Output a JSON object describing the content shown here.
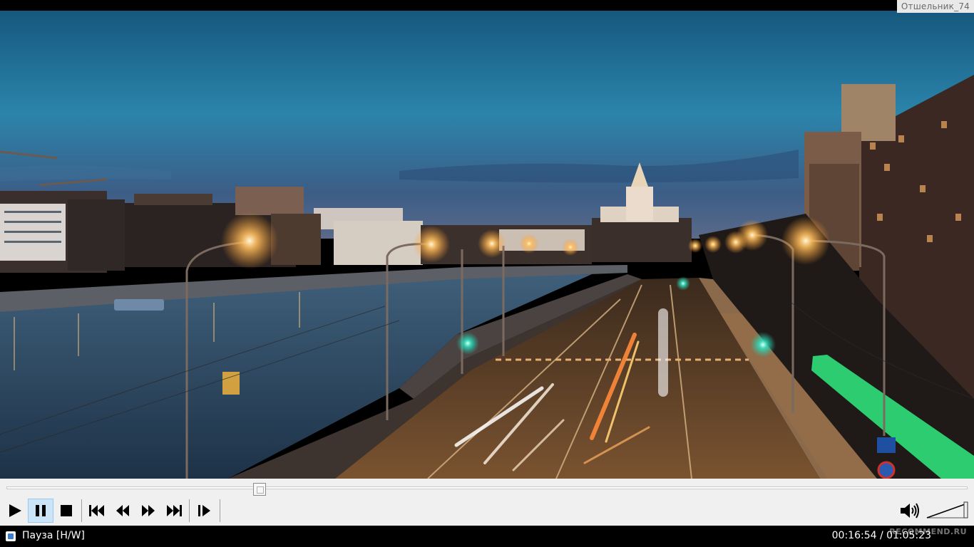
{
  "video": {
    "watermark": "Отшельник_74",
    "colors": {
      "sky_top": "#1f6f95",
      "sky_mid": "#2e86ad",
      "sky_low": "#3a5f8a",
      "river": "#2c4a63",
      "road": "#6b4a2b",
      "light": "#ffb347",
      "neon": "#3cf08a"
    }
  },
  "seek": {
    "progress_fraction": 0.263
  },
  "controls": {
    "buttons": [
      {
        "name": "play-button",
        "icon": "play-icon"
      },
      {
        "name": "pause-button",
        "icon": "pause-icon",
        "active": true
      },
      {
        "name": "stop-button",
        "icon": "stop-icon"
      },
      {
        "name": "previous-button",
        "icon": "skip-back-icon"
      },
      {
        "name": "rewind-button",
        "icon": "rewind-icon"
      },
      {
        "name": "forward-button",
        "icon": "fast-forward-icon"
      },
      {
        "name": "next-button",
        "icon": "skip-forward-icon"
      },
      {
        "name": "frame-step-button",
        "icon": "frame-step-icon"
      }
    ],
    "volume_icon": "speaker-icon",
    "volume_level": 1.0
  },
  "status": {
    "state_text": "Пауза [H/W]",
    "time_text": "00:16:54 / 01:05:23",
    "logo_text": "RECOMMEND.RU"
  }
}
